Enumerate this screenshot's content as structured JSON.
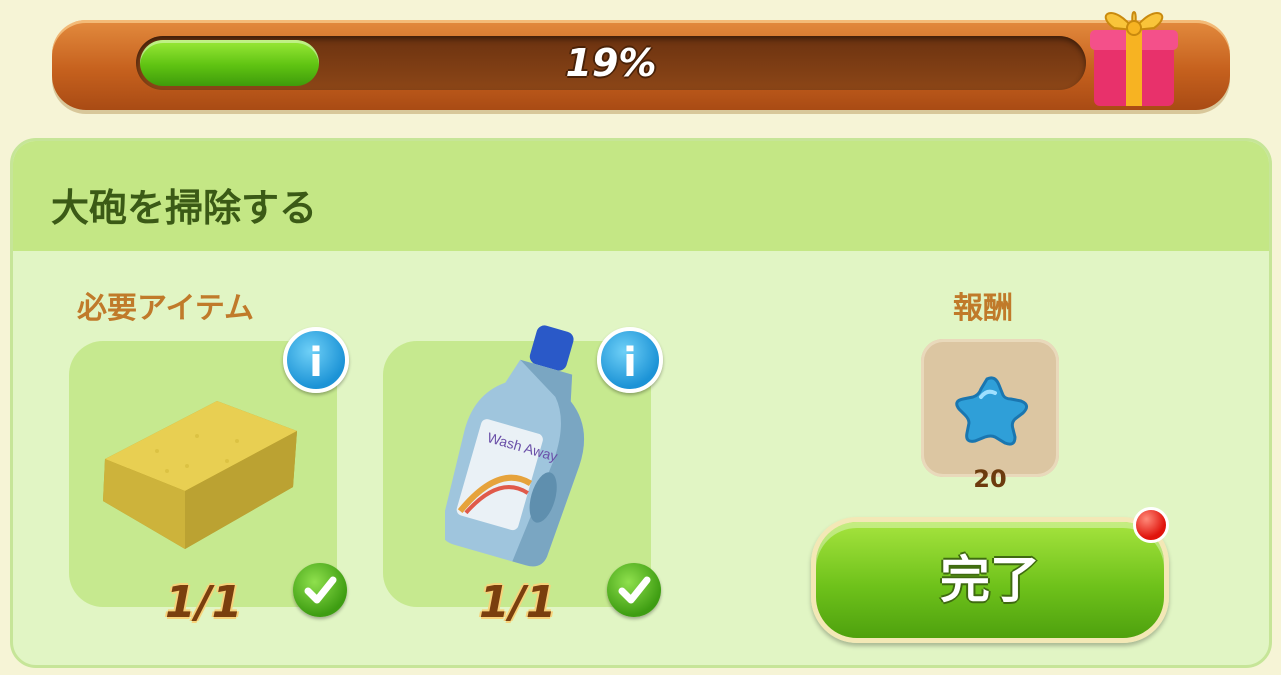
{
  "progress": {
    "percent_text": "19%",
    "fill_fraction": 0.19
  },
  "task": {
    "title": "大砲を掃除する"
  },
  "required_items": {
    "label": "必要アイテム",
    "items": [
      {
        "icon": "sponge-icon",
        "count": "1/1",
        "info": "i",
        "complete": true
      },
      {
        "icon": "detergent-bottle-icon",
        "count": "1/1",
        "info": "i",
        "bottle_label": "Wash Away",
        "complete": true
      }
    ]
  },
  "reward": {
    "label": "報酬",
    "icon": "blue-star-icon",
    "amount": "20"
  },
  "complete_button": {
    "label": "完了"
  },
  "colors": {
    "panel_bg": "#e1f5c4",
    "header_bg": "#c4e785",
    "progress_fill": "#5fc312",
    "accent": "#c07a2a"
  }
}
